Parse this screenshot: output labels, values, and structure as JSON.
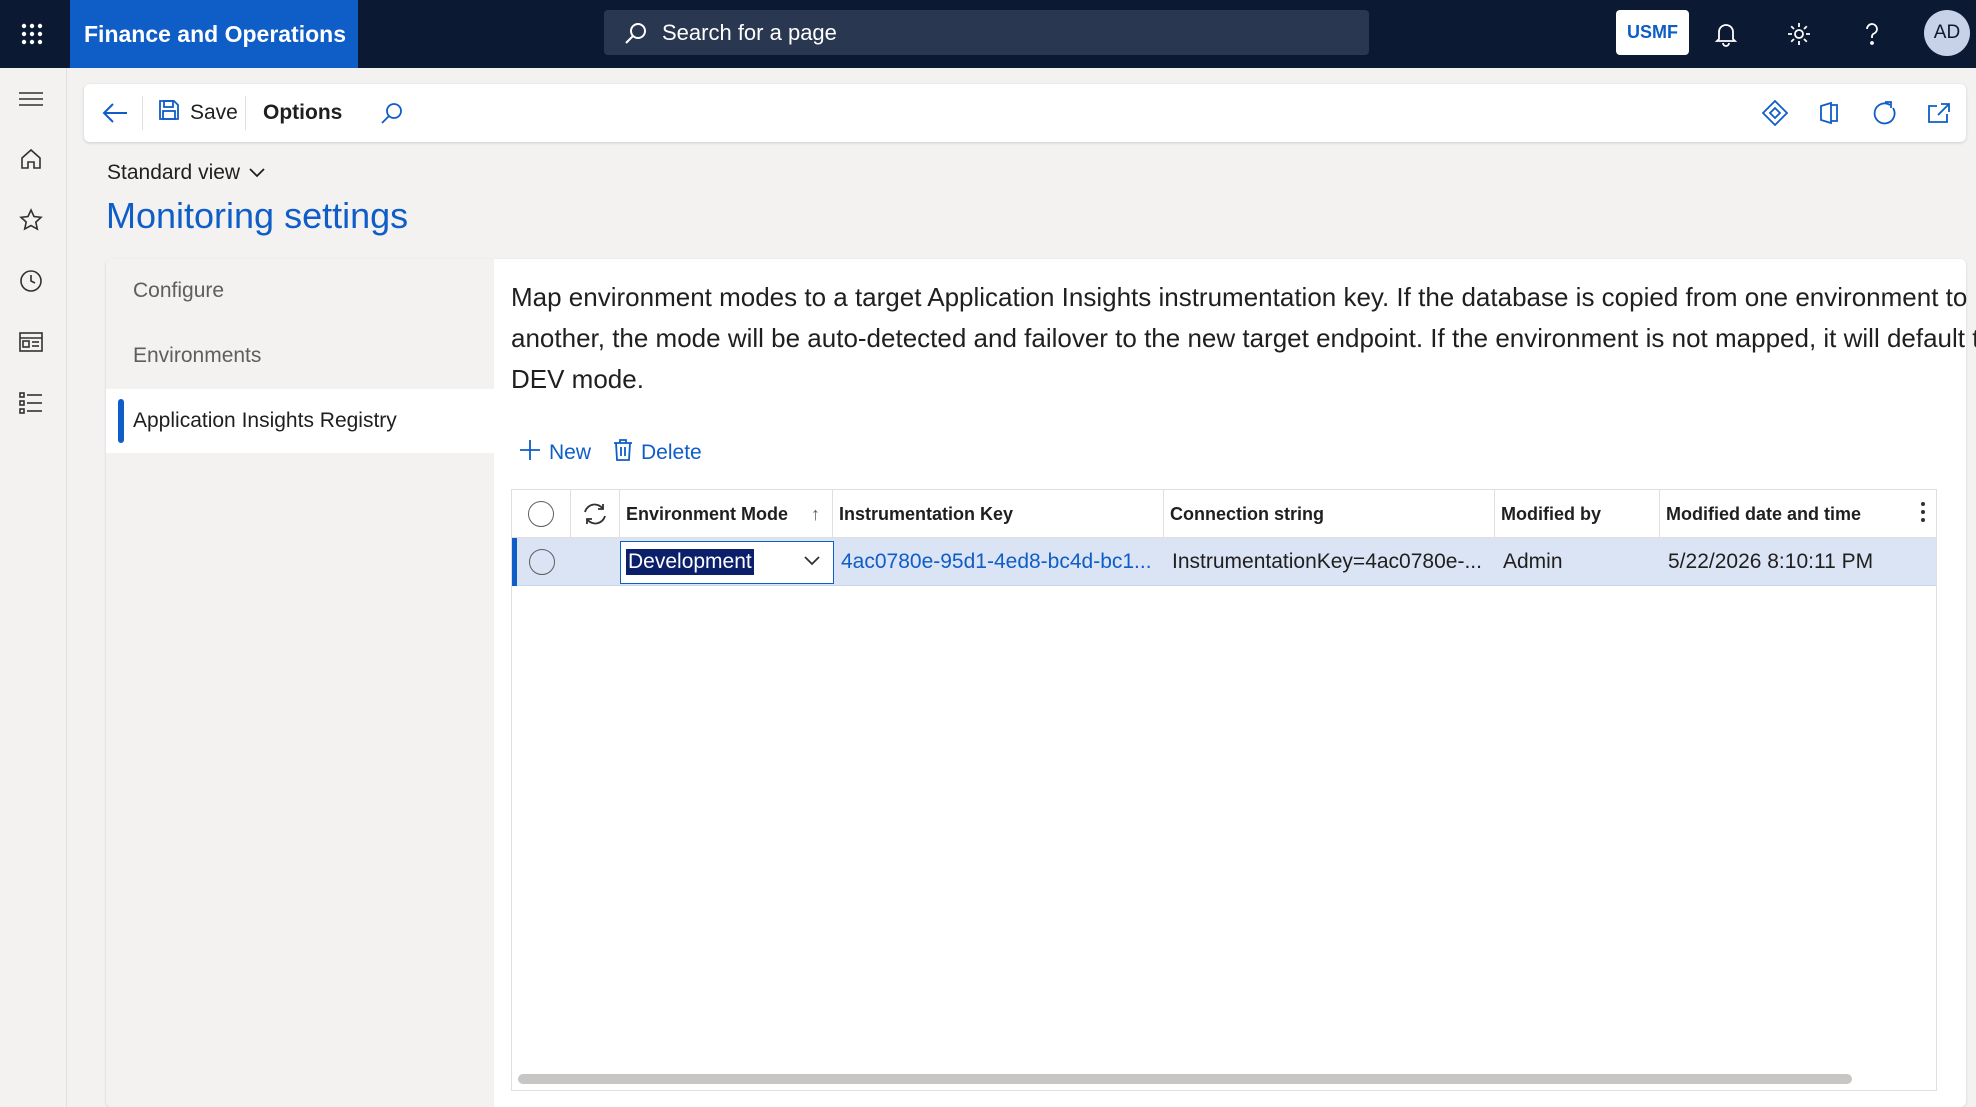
{
  "app": {
    "name": "Finance and Operations",
    "search_placeholder": "Search for a page",
    "company": "USMF",
    "avatar_initials": "AD"
  },
  "toolbar": {
    "save_label": "Save",
    "options_label": "Options"
  },
  "view": {
    "selector_label": "Standard view",
    "page_title": "Monitoring settings"
  },
  "nav": {
    "items": [
      {
        "label": "Configure"
      },
      {
        "label": "Environments"
      },
      {
        "label": "Application Insights Registry"
      }
    ]
  },
  "description": "Map environment modes to a target Application Insights instrumentation key. If the database is copied from one environment to another, the mode will be auto-detected and failover to the new target endpoint. If the environment is not mapped, it will default to the DEV mode.",
  "grid_actions": {
    "new_label": "New",
    "delete_label": "Delete"
  },
  "grid": {
    "columns": [
      "Environment Mode",
      "Instrumentation Key",
      "Connection string",
      "Modified by",
      "Modified date and time"
    ],
    "sort_indicator": "↑",
    "rows": [
      {
        "environment_mode": "Development",
        "instrumentation_key": "4ac0780e-95d1-4ed8-bc4d-bc1...",
        "connection_string": "InstrumentationKey=4ac0780e-...",
        "modified_by": "Admin",
        "modified_date": "5/22/2026 8:10:11 PM"
      }
    ]
  },
  "colors": {
    "topbar": "#0b1932",
    "brand": "#0f5dc7",
    "accent": "#0f5dc7",
    "selected_row": "#dae4f5"
  }
}
